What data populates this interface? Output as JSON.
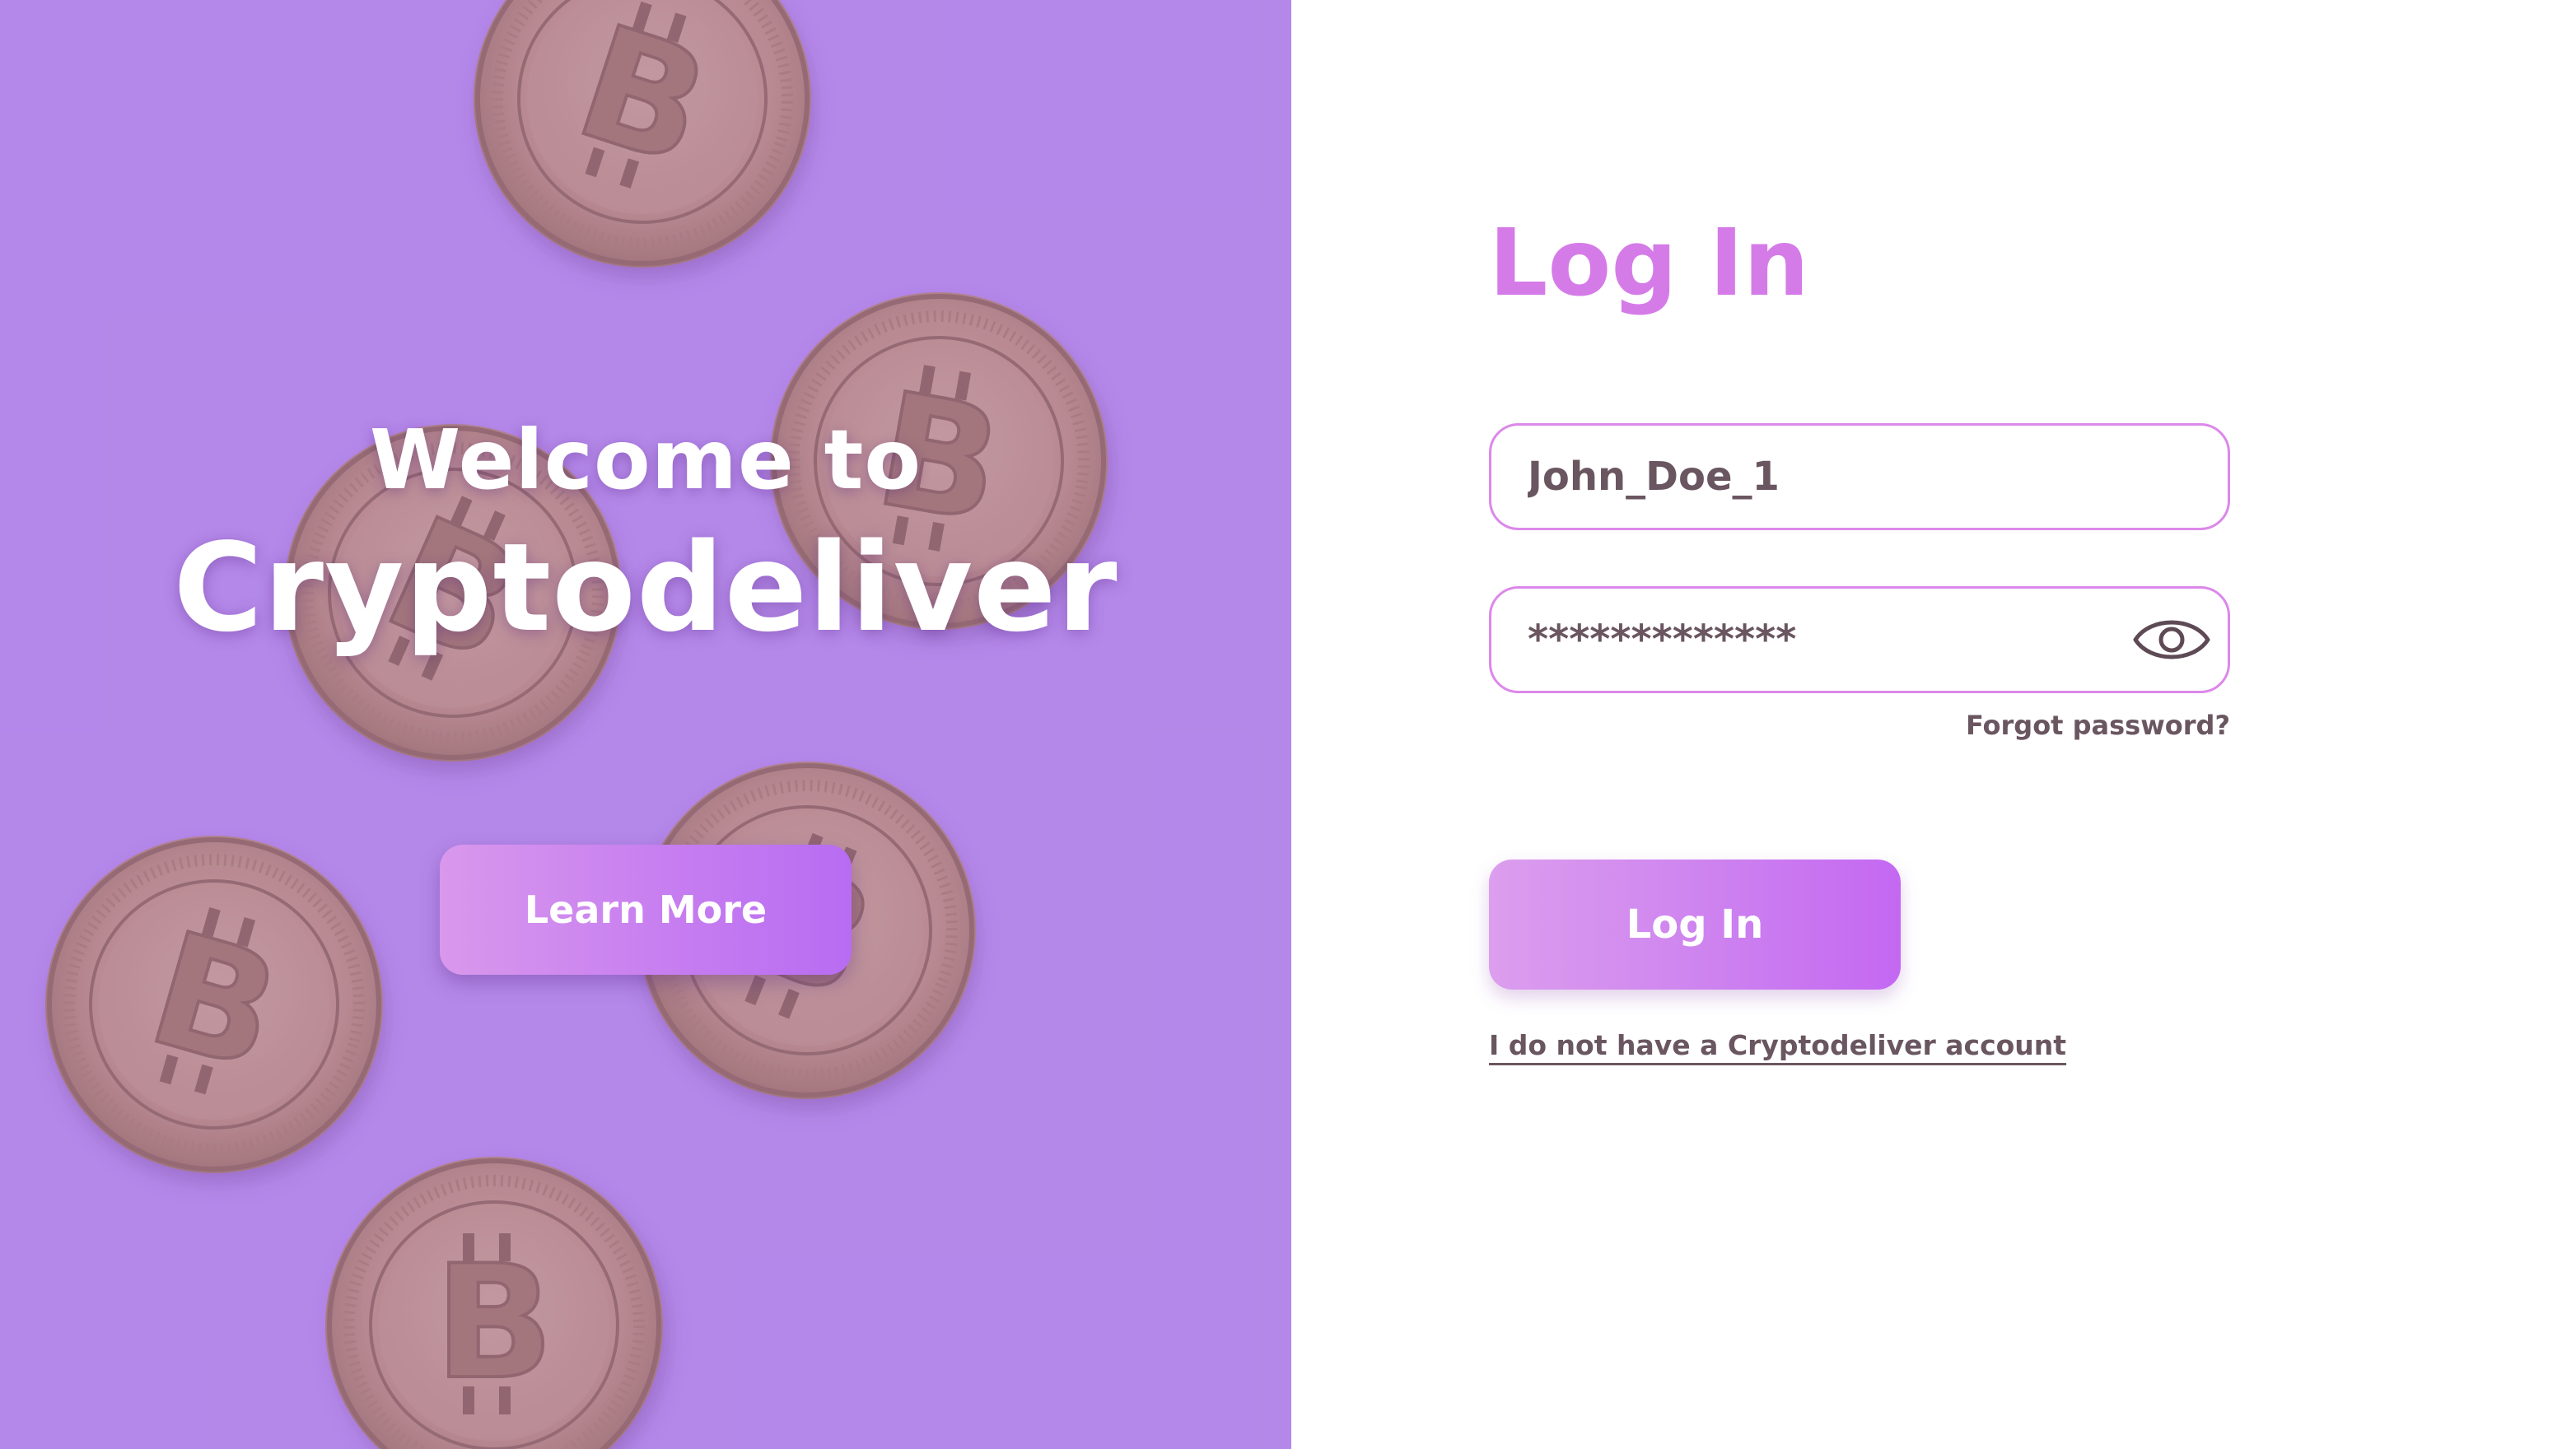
{
  "hero": {
    "welcome_text": "Welcome to",
    "brand_text": "Cryptodeliver",
    "learn_more_label": "Learn More",
    "background_color": "#b589ea",
    "coin_color": "#c99a8c"
  },
  "login_form": {
    "title": "Log In",
    "username_value": "John_Doe_1",
    "password_value": "*************",
    "show_password_icon": "eye-icon",
    "forgot_password_label": "Forgot password?",
    "submit_label": "Log In",
    "signup_link_label": "I do not have a Cryptodeliver account",
    "accent_color": "#d57be8",
    "text_color": "#6a5660"
  }
}
